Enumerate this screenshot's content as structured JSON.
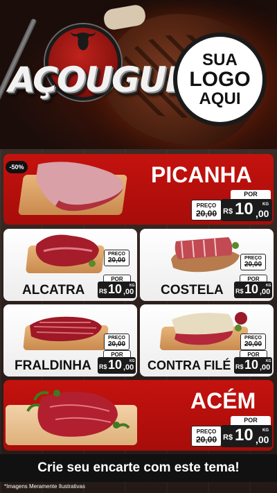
{
  "header": {
    "title": "AÇOUGUE",
    "logo": {
      "line1": "SUA",
      "line2": "LOGO",
      "line3": "AQUI"
    }
  },
  "labels": {
    "preco": "PREÇO",
    "por": "POR",
    "currency": "R$",
    "unit": "KG"
  },
  "products": {
    "picanha": {
      "name": "PICANHA",
      "badge": "-50%",
      "old_price": "20,00",
      "price_int": "10",
      "price_dec": ",00"
    },
    "alcatra": {
      "name": "ALCATRA",
      "old_price": "20,00",
      "price_int": "10",
      "price_dec": ",00"
    },
    "costela": {
      "name": "COSTELA",
      "old_price": "20,00",
      "price_int": "10",
      "price_dec": ",00"
    },
    "fraldinha": {
      "name": "FRALDINHA",
      "old_price": "20,00",
      "price_int": "10",
      "price_dec": ",00"
    },
    "contra_file": {
      "name": "CONTRA FILÉ",
      "old_price": "20,00",
      "price_int": "10",
      "price_dec": ",00"
    },
    "acem": {
      "name": "ACÉM",
      "old_price": "20,00",
      "price_int": "10",
      "price_dec": ",00"
    }
  },
  "footer": {
    "cta": "Crie seu encarte com este tema!",
    "disclaimer": "*Imagens Meramente Ilustrativas"
  },
  "colors": {
    "accent_red": "#c4120e",
    "dark": "#1b1b1b"
  }
}
